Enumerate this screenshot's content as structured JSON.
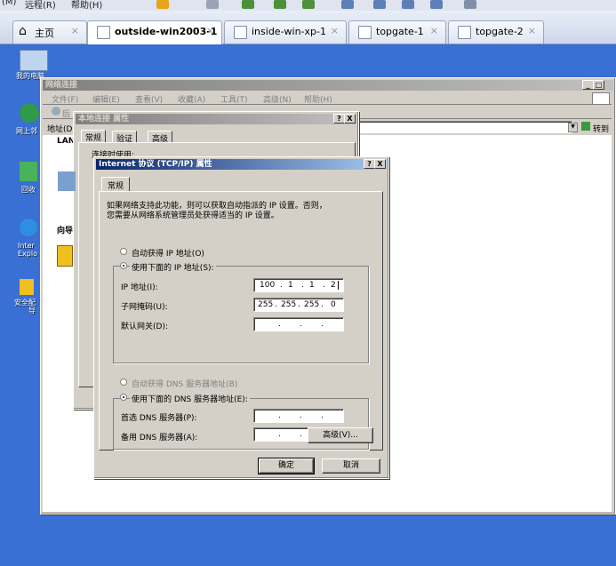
{
  "host_menu": {
    "items": [
      "(M)",
      "远程(R)",
      "帮助(H)"
    ]
  },
  "tabs": [
    {
      "label": "主页"
    },
    {
      "label": "outside-win2003-1"
    },
    {
      "label": "inside-win-xp-1"
    },
    {
      "label": "topgate-1"
    },
    {
      "label": "topgate-2"
    }
  ],
  "desktop_icons": [
    {
      "label": "我的电脑"
    },
    {
      "label": "网上邻"
    },
    {
      "label": "回收"
    },
    {
      "label": "Inter\nExplo"
    },
    {
      "label": "安全配\n导"
    }
  ],
  "netconn": {
    "title": "网络连接",
    "menu": [
      "文件(F)",
      "编辑(E)",
      "查看(V)",
      "收藏(A)",
      "工具(T)",
      "高级(N)",
      "帮助(H)"
    ],
    "back_label": "后",
    "address_label": "地址(D)",
    "go_label": "转到",
    "lan_label": "LAN",
    "wizard_label": "向导"
  },
  "localconn": {
    "title": "本地连接 属性",
    "tabs": [
      "常规",
      "验证",
      "高级"
    ],
    "connect_using": "连接时使用:"
  },
  "tcpip": {
    "title": "Internet 协议 (TCP/IP) 属性",
    "tab": "常规",
    "desc_line1": "如果网络支持此功能，则可以获取自动指派的 IP 设置。否则，",
    "desc_line2": "您需要从网络系统管理员处获得适当的 IP 设置。",
    "auto_ip": "自动获得 IP 地址(O)",
    "manual_ip": "使用下面的 IP 地址(S):",
    "ip_label": "IP 地址(I):",
    "ip": [
      "100",
      "1",
      "1",
      "2"
    ],
    "mask_label": "子网掩码(U):",
    "mask": [
      "255",
      "255",
      "255",
      "0"
    ],
    "gateway_label": "默认网关(D):",
    "auto_dns": "自动获得 DNS 服务器地址(B)",
    "manual_dns": "使用下面的 DNS 服务器地址(E):",
    "dns1_label": "首选 DNS 服务器(P):",
    "dns2_label": "备用 DNS 服务器(A):",
    "advanced": "高级(V)...",
    "ok": "确定",
    "cancel": "取消",
    "help_btn": "?",
    "close_btn": "X"
  },
  "colors": {
    "desktop": "#3a6fd3",
    "titlebar": "#0a246a",
    "dialog": "#d4d0c8"
  }
}
